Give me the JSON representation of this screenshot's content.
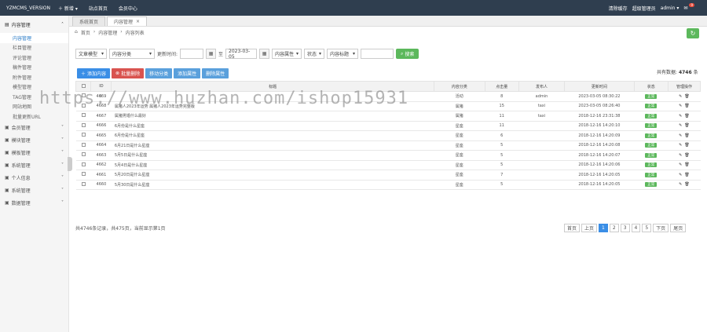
{
  "topbar": {
    "brand": "YZMCMS_VERSION",
    "nav": [
      "新增",
      "站点首页",
      "会员中心"
    ],
    "right": {
      "clear_cache": "清除缓存",
      "role": "超级管理员",
      "user": "admin",
      "badge": "9"
    }
  },
  "sidebar": {
    "section": "内容管理",
    "items": [
      "内容管理",
      "栏目管理",
      "评论管理",
      "稿件管理",
      "附件管理",
      "模型管理",
      "TAG管理",
      "网站地图",
      "批量更新URL"
    ],
    "groups": [
      "会员管理",
      "模块管理",
      "模板管理",
      "系统管理",
      "个人信息",
      "系统管理",
      "数据管理"
    ]
  },
  "tabs": [
    {
      "label": "系统首页"
    },
    {
      "label": "内容管理"
    }
  ],
  "breadcrumb": [
    "首页",
    "内容管理",
    "内容列表"
  ],
  "filters": {
    "model": "文章模型",
    "category": "内容分类",
    "date_label": "更新时间:",
    "date_from": "",
    "date_to": "2023-03-05",
    "attr": "内容属性",
    "status": "状态",
    "title_sel": "内容标题",
    "keyword": "",
    "search": "搜索"
  },
  "actions": [
    "添加内容",
    "批量删除",
    "移动分类",
    "添加属性",
    "删除属性"
  ],
  "total": {
    "label": "共有数据:",
    "count": "4746",
    "unit": "条"
  },
  "table": {
    "headers": [
      "ID",
      "标题",
      "内容分类",
      "点击量",
      "发布人",
      "更新时间",
      "状态",
      "管理操作"
    ],
    "rows": [
      {
        "id": "4669",
        "title": "",
        "cat": "活动",
        "hits": "8",
        "user": "admin",
        "time": "2023-03-05 08:30:22",
        "status": "正常"
      },
      {
        "id": "4668",
        "title": "属猪人2023年运势 属猪人2023年运势完整版",
        "cat": "属猪",
        "hits": "15",
        "user": "taxi",
        "time": "2023-03-05 08:26:40",
        "status": "正常"
      },
      {
        "id": "4667",
        "title": "属猪男婚什么最好",
        "cat": "属猪",
        "hits": "11",
        "user": "taxi",
        "time": "2018-12-16 23:31:38",
        "status": "正常"
      },
      {
        "id": "4666",
        "title": "6月份是什么星座",
        "cat": "星座",
        "hits": "11",
        "user": "",
        "time": "2018-12-16 14:20:10",
        "status": "正常"
      },
      {
        "id": "4665",
        "title": "6月份是什么星座",
        "cat": "星座",
        "hits": "6",
        "user": "",
        "time": "2018-12-16 14:20:09",
        "status": "正常"
      },
      {
        "id": "4664",
        "title": "6月21日是什么星座",
        "cat": "星座",
        "hits": "5",
        "user": "",
        "time": "2018-12-16 14:20:08",
        "status": "正常"
      },
      {
        "id": "4663",
        "title": "5月5日是什么星座",
        "cat": "星座",
        "hits": "5",
        "user": "",
        "time": "2018-12-16 14:20:07",
        "status": "正常"
      },
      {
        "id": "4662",
        "title": "5月4日是什么星座",
        "cat": "星座",
        "hits": "5",
        "user": "",
        "time": "2018-12-16 14:20:06",
        "status": "正常"
      },
      {
        "id": "4661",
        "title": "5月20日是什么星座",
        "cat": "星座",
        "hits": "7",
        "user": "",
        "time": "2018-12-16 14:20:05",
        "status": "正常"
      },
      {
        "id": "4660",
        "title": "5月30日是什么星座",
        "cat": "星座",
        "hits": "5",
        "user": "",
        "time": "2018-12-16 14:20:05",
        "status": "正常"
      }
    ]
  },
  "pager": {
    "info": "共4746条记录，共475页，当前显示第1页",
    "first": "首页",
    "prev": "上页",
    "pages": [
      "1",
      "2",
      "3",
      "4",
      "5"
    ],
    "next": "下页",
    "last": "尾页"
  },
  "watermark": "https://www.huzhan.com/ishop15931",
  "colors": {
    "topbar": "#2f3e4f",
    "primary": "#3a8ee6",
    "danger": "#d9534f",
    "success": "#5cb85c"
  }
}
